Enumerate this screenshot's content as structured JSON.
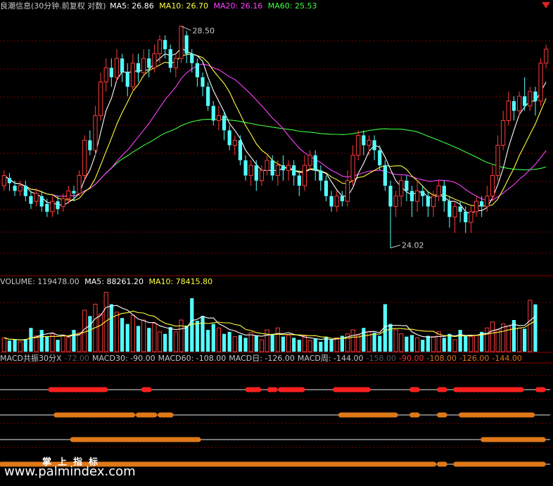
{
  "colors": {
    "up": "#ff3b3b",
    "down": "#54ffff",
    "ma5": "#ffffff",
    "ma10": "#ffff40",
    "ma20": "#ff40ff",
    "ma60": "#40ff40",
    "grid": "#7a0000",
    "text": "#c8c8c8",
    "macd_red": "#ff2020",
    "macd_orange": "#e07818",
    "macd_gray": "#9a9a9a"
  },
  "main_panel": {
    "title": "良潮信息(30分钟.前复权 对数)",
    "ma5_label": "MA5: 26.86",
    "ma10_label": "MA10: 26.70",
    "ma20_label": "MA20: 26.16",
    "ma60_label": "MA60: 25.53",
    "high_label": "28.50",
    "low_label": "24.02"
  },
  "volume_panel": {
    "vol_label": "VOLUME: 119478.00",
    "ma5_label": "MA5: 88261.20",
    "ma10_label": "MA10: 78415.80"
  },
  "macd_panel": {
    "labels": [
      {
        "text": "MACD共振30分X",
        "color": "#c8c8c8"
      },
      {
        "text": "-72.00",
        "color": "#555555"
      },
      {
        "text": "MACD30: -90.00",
        "color": "#c8c8c8"
      },
      {
        "text": "MACD60: -108.00",
        "color": "#c8c8c8"
      },
      {
        "text": "MACD日: -126.00",
        "color": "#c8c8c8"
      },
      {
        "text": "MACD周: -144.00",
        "color": "#c8c8c8"
      },
      {
        "text": "-158.00",
        "color": "#555555"
      },
      {
        "text": "-90.00",
        "color": "#ff3030"
      },
      {
        "text": "-108.00",
        "color": "#e07818"
      },
      {
        "text": "-126.00",
        "color": "#e07818"
      },
      {
        "text": "-144.00",
        "color": "#e07818"
      }
    ]
  },
  "chart_data": [
    {
      "type": "candlestick",
      "title": "良潮信息(30分钟.前复权 对数)",
      "ylim": [
        23.6,
        28.8
      ],
      "annotations": {
        "high": 28.5,
        "low": 24.02
      },
      "last_values": {
        "MA5": 26.86,
        "MA10": 26.7,
        "MA20": 26.16,
        "MA60": 25.53
      },
      "candles": [
        [
          25.2,
          25.4,
          25.5,
          25.1
        ],
        [
          25.35,
          25.25,
          25.45,
          25.1
        ],
        [
          25.2,
          25.1,
          25.3,
          25.0
        ],
        [
          25.1,
          25.2,
          25.3,
          25.0
        ],
        [
          25.2,
          25.0,
          25.3,
          24.9
        ],
        [
          25.0,
          24.85,
          25.1,
          24.75
        ],
        [
          24.9,
          25.05,
          25.15,
          24.8
        ],
        [
          25.0,
          24.8,
          25.1,
          24.7
        ],
        [
          24.85,
          24.7,
          24.95,
          24.6
        ],
        [
          24.7,
          24.9,
          25.0,
          24.6
        ],
        [
          24.9,
          24.75,
          25.0,
          24.65
        ],
        [
          24.8,
          24.95,
          25.05,
          24.7
        ],
        [
          24.95,
          25.1,
          25.2,
          24.85
        ],
        [
          25.1,
          25.05,
          25.2,
          24.9
        ],
        [
          25.05,
          25.4,
          25.5,
          25.0
        ],
        [
          25.4,
          26.1,
          26.2,
          25.3
        ],
        [
          26.1,
          25.9,
          26.3,
          25.8
        ],
        [
          25.9,
          26.6,
          26.8,
          25.8
        ],
        [
          26.6,
          27.3,
          27.5,
          26.5
        ],
        [
          27.3,
          27.6,
          27.8,
          27.1
        ],
        [
          27.6,
          27.4,
          27.8,
          27.2
        ],
        [
          27.4,
          27.8,
          28.0,
          27.3
        ],
        [
          27.8,
          27.5,
          27.9,
          27.3
        ],
        [
          27.5,
          27.2,
          27.7,
          27.0
        ],
        [
          27.2,
          27.7,
          27.9,
          27.1
        ],
        [
          27.7,
          27.5,
          27.9,
          27.3
        ],
        [
          27.5,
          27.8,
          28.0,
          27.4
        ],
        [
          27.8,
          27.6,
          28.0,
          27.4
        ],
        [
          27.6,
          27.9,
          28.1,
          27.5
        ],
        [
          27.9,
          28.2,
          28.3,
          27.7
        ],
        [
          28.2,
          28.0,
          28.3,
          27.8
        ],
        [
          28.0,
          27.6,
          28.1,
          27.5
        ],
        [
          27.6,
          27.8,
          27.9,
          27.4
        ],
        [
          27.8,
          28.5,
          28.5,
          27.7
        ],
        [
          28.3,
          27.9,
          28.4,
          27.7
        ],
        [
          27.9,
          27.7,
          28.0,
          27.5
        ],
        [
          27.7,
          27.4,
          27.8,
          27.2
        ],
        [
          27.4,
          27.2,
          27.5,
          27.0
        ],
        [
          27.2,
          26.8,
          27.3,
          26.7
        ],
        [
          26.8,
          26.5,
          26.9,
          26.4
        ],
        [
          26.5,
          26.6,
          26.8,
          26.3
        ],
        [
          26.6,
          26.3,
          26.7,
          26.1
        ],
        [
          26.3,
          26.0,
          26.4,
          25.9
        ],
        [
          26.0,
          26.1,
          26.2,
          25.8
        ],
        [
          26.1,
          25.7,
          26.2,
          25.6
        ],
        [
          25.7,
          25.4,
          25.8,
          25.3
        ],
        [
          25.4,
          25.6,
          25.7,
          25.2
        ],
        [
          25.6,
          25.3,
          25.7,
          25.1
        ],
        [
          25.3,
          25.5,
          25.6,
          25.2
        ],
        [
          25.5,
          25.7,
          25.8,
          25.4
        ],
        [
          25.7,
          25.4,
          25.8,
          25.3
        ],
        [
          25.4,
          25.6,
          25.7,
          25.2
        ],
        [
          25.6,
          25.5,
          25.8,
          25.3
        ],
        [
          25.5,
          25.6,
          25.7,
          25.3
        ],
        [
          25.6,
          25.4,
          25.7,
          25.2
        ],
        [
          25.4,
          25.2,
          25.5,
          25.0
        ],
        [
          25.2,
          25.6,
          25.8,
          25.1
        ],
        [
          25.6,
          25.8,
          25.9,
          25.5
        ],
        [
          25.8,
          25.5,
          25.9,
          25.3
        ],
        [
          25.5,
          25.3,
          25.6,
          25.1
        ],
        [
          25.3,
          25.0,
          25.4,
          24.9
        ],
        [
          25.0,
          24.8,
          25.1,
          24.7
        ],
        [
          24.8,
          25.0,
          25.1,
          24.7
        ],
        [
          25.0,
          24.9,
          25.1,
          24.8
        ],
        [
          24.9,
          25.3,
          25.5,
          24.8
        ],
        [
          25.3,
          25.8,
          26.0,
          25.2
        ],
        [
          25.8,
          26.2,
          26.3,
          25.7
        ],
        [
          26.2,
          26.0,
          26.3,
          25.8
        ],
        [
          26.0,
          26.1,
          26.2,
          25.8
        ],
        [
          26.1,
          25.9,
          26.2,
          25.7
        ],
        [
          25.9,
          25.6,
          26.0,
          25.5
        ],
        [
          25.6,
          25.2,
          25.7,
          25.1
        ],
        [
          25.2,
          24.8,
          25.3,
          24.02
        ],
        [
          24.8,
          25.0,
          25.1,
          24.6
        ],
        [
          25.0,
          25.3,
          25.4,
          24.8
        ],
        [
          25.3,
          25.1,
          25.4,
          24.9
        ],
        [
          25.1,
          24.9,
          25.2,
          24.6
        ],
        [
          24.9,
          25.1,
          25.3,
          24.7
        ],
        [
          25.1,
          25.0,
          25.2,
          24.8
        ],
        [
          25.0,
          24.8,
          25.1,
          24.6
        ],
        [
          24.8,
          25.0,
          25.1,
          24.6
        ],
        [
          25.0,
          25.2,
          25.3,
          24.9
        ],
        [
          25.2,
          24.9,
          25.3,
          24.7
        ],
        [
          24.9,
          24.6,
          25.0,
          24.4
        ],
        [
          24.6,
          24.8,
          24.9,
          24.3
        ],
        [
          24.8,
          24.7,
          24.9,
          24.5
        ],
        [
          24.7,
          24.5,
          24.8,
          24.3
        ],
        [
          24.5,
          24.7,
          24.8,
          24.3
        ],
        [
          24.7,
          24.9,
          25.0,
          24.6
        ],
        [
          24.9,
          24.8,
          25.0,
          24.6
        ],
        [
          24.8,
          25.0,
          25.2,
          24.7
        ],
        [
          25.0,
          25.4,
          25.6,
          24.9
        ],
        [
          25.4,
          26.0,
          26.2,
          25.3
        ],
        [
          26.0,
          26.5,
          26.7,
          25.9
        ],
        [
          26.5,
          26.9,
          27.1,
          26.4
        ],
        [
          26.9,
          26.7,
          27.0,
          26.5
        ],
        [
          26.7,
          27.0,
          27.1,
          26.6
        ],
        [
          27.0,
          26.8,
          27.4,
          26.7
        ],
        [
          26.8,
          27.1,
          27.2,
          26.7
        ],
        [
          27.1,
          26.9,
          27.2,
          26.6
        ],
        [
          26.9,
          27.7,
          27.8,
          26.8
        ],
        [
          27.7,
          28.0,
          28.1,
          27.6
        ]
      ]
    },
    {
      "type": "bar",
      "title": "VOLUME",
      "ylabel": "Volume",
      "ylim": [
        0,
        160000
      ],
      "last_values": {
        "VOLUME": 119478.0,
        "MA5": 88261.2,
        "MA10": 78415.8
      },
      "values": [
        35000,
        28000,
        30000,
        25000,
        32000,
        60000,
        40000,
        55000,
        38000,
        45000,
        30000,
        42000,
        36000,
        55000,
        48000,
        105000,
        90000,
        120000,
        95000,
        150000,
        120000,
        100000,
        85000,
        70000,
        92000,
        65000,
        80000,
        60000,
        72000,
        50000,
        45000,
        62000,
        50000,
        80000,
        66000,
        135000,
        78000,
        90000,
        55000,
        70000,
        60000,
        45000,
        50000,
        38000,
        42000,
        35000,
        48000,
        40000,
        30000,
        55000,
        45000,
        60000,
        38000,
        42000,
        35000,
        30000,
        40000,
        28000,
        32000,
        25000,
        38000,
        30000,
        35000,
        40000,
        45000,
        55000,
        42000,
        60000,
        50000,
        48000,
        40000,
        120000,
        70000,
        55000,
        45000,
        38000,
        42000,
        35000,
        30000,
        40000,
        38000,
        50000,
        35000,
        45000,
        30000,
        55000,
        40000,
        38000,
        42000,
        50000,
        60000,
        75000,
        55000,
        70000,
        65000,
        80000,
        60000,
        58000,
        130000,
        119478
      ]
    },
    {
      "type": "timeline",
      "title": "MACD共振30分X",
      "x_range": [
        0,
        100
      ],
      "rows": [
        {
          "name": "MACD30",
          "color": "#ff2020",
          "segments": [
            [
              9,
              19
            ],
            [
              26,
              27
            ],
            [
              45,
              47
            ],
            [
              49,
              50
            ],
            [
              51,
              55
            ],
            [
              61,
              67
            ],
            [
              75,
              76
            ],
            [
              80,
              81
            ],
            [
              83,
              95
            ],
            [
              98,
              99
            ]
          ]
        },
        {
          "name": "MACD60",
          "color": "#e07818",
          "segments": [
            [
              10,
              24
            ],
            [
              25,
              28
            ],
            [
              29,
              31
            ],
            [
              62,
              72
            ],
            [
              75,
              76
            ],
            [
              80,
              81
            ],
            [
              84,
              97
            ]
          ]
        },
        {
          "name": "MACD日",
          "color": "#e07818",
          "segments": [
            [
              13,
              36
            ],
            [
              88,
              99
            ]
          ]
        },
        {
          "name": "MACD周",
          "color": "#e07818",
          "segments": [
            [
              0,
              79
            ],
            [
              80,
              81
            ],
            [
              83,
              99
            ]
          ]
        }
      ]
    }
  ],
  "watermark": {
    "cn": "掌上指标",
    "url": "www.palmindex.com"
  }
}
